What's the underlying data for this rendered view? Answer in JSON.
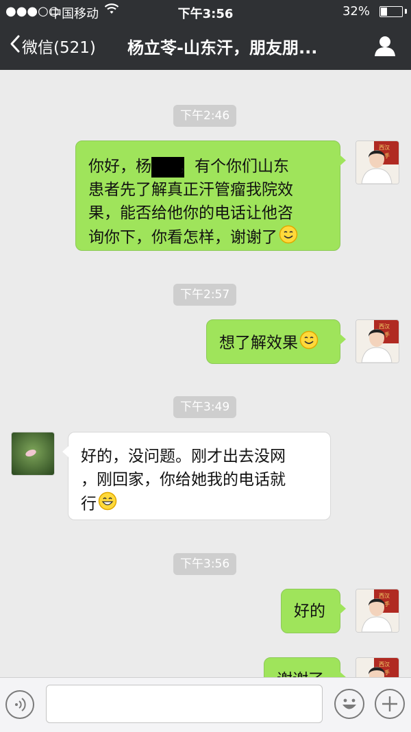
{
  "status_bar": {
    "signal": "●●●○○",
    "carrier": "中国移动",
    "time": "下午3:56",
    "battery": "32%"
  },
  "nav": {
    "back_label": "微信(521)",
    "title": "杨立苓-山东汗，朋友朋..."
  },
  "messages": [
    {
      "kind": "timestamp",
      "text": "下午2:46"
    },
    {
      "kind": "message",
      "side": "right",
      "lines": [
        "你好，杨",
        "，有个你们山东",
        "患者先了解真正汗管瘤我院效",
        "果，能否给他你的电话让他咨",
        "询你下，你看怎样，谢谢了"
      ],
      "emoji": "smile"
    },
    {
      "kind": "timestamp",
      "text": "下午2:57"
    },
    {
      "kind": "message",
      "side": "right",
      "text": "想了解效果",
      "emoji": "smile"
    },
    {
      "kind": "timestamp",
      "text": "下午3:49"
    },
    {
      "kind": "message",
      "side": "left",
      "lines": [
        "好的，没问题。刚才出去没网",
        "，刚回家，你给她我的电话就",
        "行"
      ],
      "emoji": "grin"
    },
    {
      "kind": "timestamp",
      "text": "下午3:56"
    },
    {
      "kind": "message",
      "side": "right",
      "text": "好的"
    },
    {
      "kind": "message",
      "side": "right",
      "text": "谢谢了",
      "partial": true
    }
  ],
  "input": {
    "value": "",
    "placeholder": ""
  },
  "colors": {
    "header_bg": "#2f3134",
    "chat_bg": "#ebebeb",
    "sent_bubble": "#9fe45b",
    "received_bubble": "#ffffff"
  }
}
